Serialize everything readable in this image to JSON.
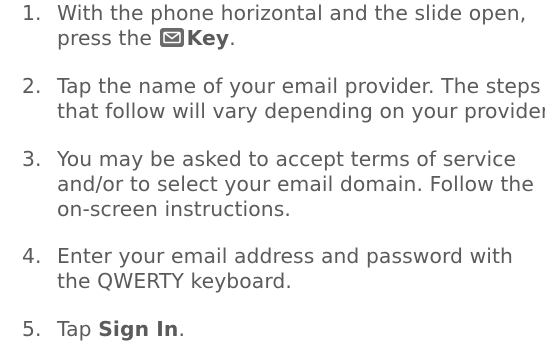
{
  "steps": [
    {
      "number": "1.",
      "line1": "With the phone horizontal and the slide open,",
      "line2_before": "press the",
      "key_icon": "email-key-icon",
      "line2_bold": "Key",
      "line2_after": "."
    },
    {
      "number": "2.",
      "line1": "Tap the name of your email provider. The steps",
      "line2": "that follow will vary depending on your provider."
    },
    {
      "number": "3.",
      "line1": "You may be asked to accept terms of service",
      "line2": "and/or to select your email domain. Follow the",
      "line3": "on-screen instructions."
    },
    {
      "number": "4.",
      "line1": "Enter your email address and password with",
      "line2": "the QWERTY keyboard."
    },
    {
      "number": "5.",
      "line1_before": "Tap",
      "line1_bold": "Sign In",
      "line1_after": "."
    }
  ],
  "colors": {
    "text": "#5b5b5b",
    "icon_bg": "#6a6a6a"
  }
}
